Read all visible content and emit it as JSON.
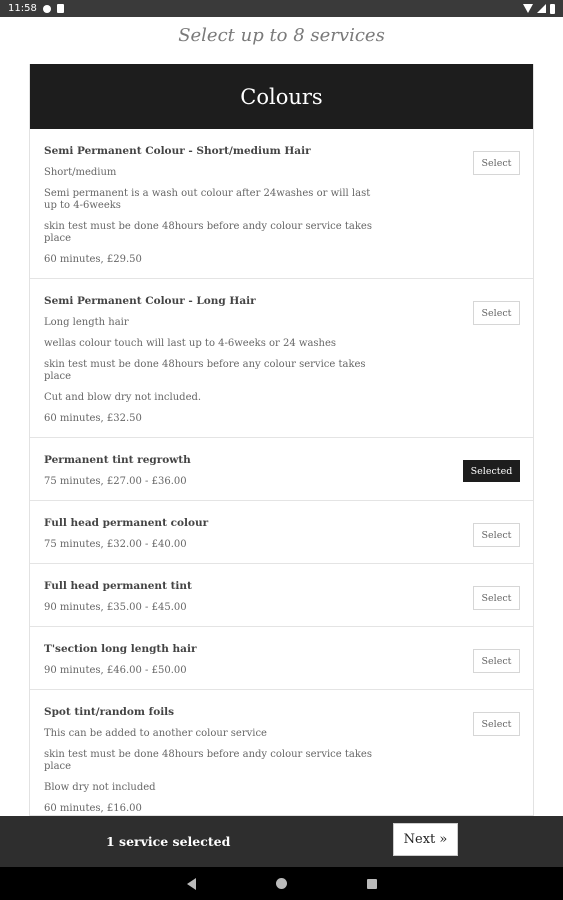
{
  "status_bar": {
    "time": "11:58",
    "icons": [
      "gear-icon",
      "sd-card-icon",
      "wifi-icon",
      "signal-icon",
      "battery-icon"
    ]
  },
  "header": {
    "subtitle": "Select up to 8 services"
  },
  "category": {
    "title": "Colours"
  },
  "services": [
    {
      "name": "Semi Permanent Colour - Short/medium Hair",
      "lines": [
        "Short/medium",
        "Semi permanent is a wash out colour after 24washes or will last up to 4-6weeks",
        "skin test must be done 48hours before andy colour service takes place"
      ],
      "meta": "60 minutes, £29.50",
      "button": "Select",
      "selected": false
    },
    {
      "name": "Semi Permanent Colour - Long Hair",
      "lines": [
        "Long length hair",
        "wellas colour touch will last up to 4-6weeks or 24 washes",
        "skin test must be done 48hours before any colour service takes place",
        "Cut and blow dry not included."
      ],
      "meta": "60 minutes, £32.50",
      "button": "Select",
      "selected": false
    },
    {
      "name": "Permanent tint regrowth",
      "lines": [],
      "meta": "75 minutes, £27.00 - £36.00",
      "button": "Selected",
      "selected": true
    },
    {
      "name": "Full head permanent colour",
      "lines": [],
      "meta": "75 minutes, £32.00 - £40.00",
      "button": "Select",
      "selected": false
    },
    {
      "name": "Full head permanent tint",
      "lines": [],
      "meta": "90 minutes, £35.00 - £45.00",
      "button": "Select",
      "selected": false
    },
    {
      "name": "T'section long length hair",
      "lines": [],
      "meta": "90 minutes, £46.00 - £50.00",
      "button": "Select",
      "selected": false
    },
    {
      "name": "Spot tint/random foils",
      "lines": [
        "This can be added to another colour service",
        "skin test must be done 48hours before andy colour service takes place",
        "Blow dry not included"
      ],
      "meta": "60 minutes, £16.00",
      "button": "Select",
      "selected": false
    }
  ],
  "footer": {
    "count_text": "1 service selected",
    "next_label": "Next »"
  },
  "nav": {
    "icons": [
      "back-icon",
      "home-icon",
      "recent-apps-icon"
    ]
  },
  "colors": {
    "header_bg": "#1d1d1d",
    "bottom_bar_bg": "#2e2e2e",
    "selected_bg": "#1d1d1d"
  }
}
